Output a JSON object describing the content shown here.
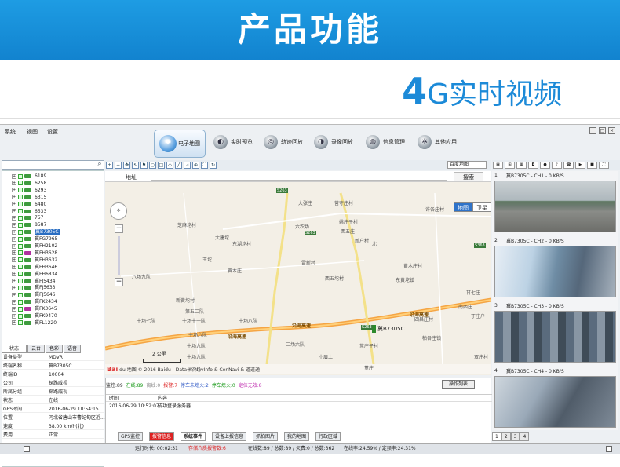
{
  "banner": {
    "title": "产品功能"
  },
  "subtitle": {
    "big": "4",
    "text": "G实时视频"
  },
  "menu": [
    "系统",
    "视图",
    "设置"
  ],
  "window_controls": [
    "_",
    "□",
    "×"
  ],
  "nav": [
    {
      "label": "电子地图",
      "icon": "map-globe-icon",
      "active": true
    },
    {
      "label": "实时预览",
      "icon": "camera-icon"
    },
    {
      "label": "轨迹回放",
      "icon": "track-icon"
    },
    {
      "label": "录像回放",
      "icon": "video-icon"
    },
    {
      "label": "信息管理",
      "icon": "info-icon"
    },
    {
      "label": "其他应用",
      "icon": "gear-icon"
    }
  ],
  "vehicles": [
    "6189",
    "6258",
    "6293",
    "6315",
    "6480",
    "6533",
    "757",
    "8587",
    "冀B7305C",
    "冀FG7965",
    "冀FH2102",
    "冀FH3628",
    "冀FH3632",
    "冀FH3646",
    "冀FH6834",
    "冀FJ5434",
    "冀FJ5633",
    "冀FJ5646",
    "冀FK2434",
    "冀FK3645",
    "冀FK9470",
    "冀FL1220"
  ],
  "vehicle_selected": "冀B7305C",
  "left_tabs": [
    "状态",
    "云台",
    "色彩",
    "语音"
  ],
  "info": [
    {
      "k": "设备类型",
      "v": "MDVR"
    },
    {
      "k": "终端名称",
      "v": "冀B7305C"
    },
    {
      "k": "终端ID",
      "v": "10004"
    },
    {
      "k": "公司",
      "v": "探路威视"
    },
    {
      "k": "所属分组",
      "v": "探路威视"
    },
    {
      "k": "状态",
      "v": "在线"
    },
    {
      "k": "GPS时间",
      "v": "2016-06-29 10:54:15"
    },
    {
      "k": "位置",
      "v": "河北省唐山市曹妃甸区近..."
    },
    {
      "k": "速度",
      "v": "38.00 km/h(北)"
    },
    {
      "k": "费用",
      "v": "正常"
    }
  ],
  "map": {
    "type_select": "百度地图",
    "address_label": "地址",
    "search_btn": "搜索",
    "map_types": [
      "地图",
      "卫星"
    ],
    "labels": [
      "大张庄",
      "营守庄村",
      "许各庄村",
      "西五庄",
      "芝麻坨村",
      "六农场",
      "姚庄子村",
      "大唐坨",
      "东湖坨村",
      "新户村",
      "北",
      "王坨",
      "黄木庄",
      "雷新村",
      "东黄坨镇",
      "八场九队",
      "西五坨村",
      "黄木庄村",
      "第五二队",
      "新黄坨村",
      "十场七队",
      "十场十一队",
      "十场八队",
      "沿海高速",
      "沿海高速",
      "沿海高速",
      "十场六队",
      "十场九队",
      "二场六队",
      "十场九队",
      "十农场",
      "小眉上",
      "常庄子村",
      "董庄",
      "柏各庄镇",
      "甘七庄",
      "南西庄",
      "丁庄户",
      "四吕庄村",
      "双庄村"
    ],
    "road_badges": [
      "S263",
      "S263",
      "S263",
      "S363"
    ],
    "car_label": "冀B7305C",
    "scale": "2 公里",
    "copyright_logo": "Bai",
    "copyright": "du 地图 © 2016 Baidu - Data © NavInfo & CenNavi & 道道通"
  },
  "events": {
    "stats": [
      {
        "t": "监控:89",
        "c": "#222"
      },
      {
        "t": "在线:89",
        "c": "#1a9a1a"
      },
      {
        "t": "离线:0",
        "c": "#888"
      },
      {
        "t": "报警:7",
        "c": "#d22"
      },
      {
        "t": "停车未熄火:2",
        "c": "#2a55c4"
      },
      {
        "t": "停车熄火:0",
        "c": "#1a9a1a"
      },
      {
        "t": "定位无效:8",
        "c": "#c030b0"
      }
    ],
    "list_btn": "操作列表",
    "head_time": "时间",
    "head_content": "内容",
    "row_time": "2016-06-29 10:52:07",
    "row_content": "成功登录服务器"
  },
  "bottom_tabs": [
    "GPS监控",
    "报警信息",
    "系统事件",
    "设备上报信息",
    "抓拍图片",
    "我的地图",
    "行政区域"
  ],
  "videos": [
    {
      "num": "1",
      "title": "冀B7305C - CH1 - 0 KB/S"
    },
    {
      "num": "2",
      "title": "冀B7305C - CH2 - 0 KB/S"
    },
    {
      "num": "3",
      "title": "冀B7305C - CH3 - 0 KB/S"
    },
    {
      "num": "4",
      "title": "冀B7305C - CH4 - 0 KB/S"
    }
  ],
  "video_pages": [
    "1",
    "2",
    "3",
    "4"
  ],
  "status": {
    "runtime": "运行时长: 00:02:31",
    "alarm": "存储介质报警数:6",
    "online": "在线数:89 / 总数:89 / 欠费:0 / 总数:362",
    "rate": "在线率:24.59% / 定频率:24.31%"
  },
  "colors": {
    "accent": "#1283cf",
    "nav_active": "#2f73c9"
  }
}
